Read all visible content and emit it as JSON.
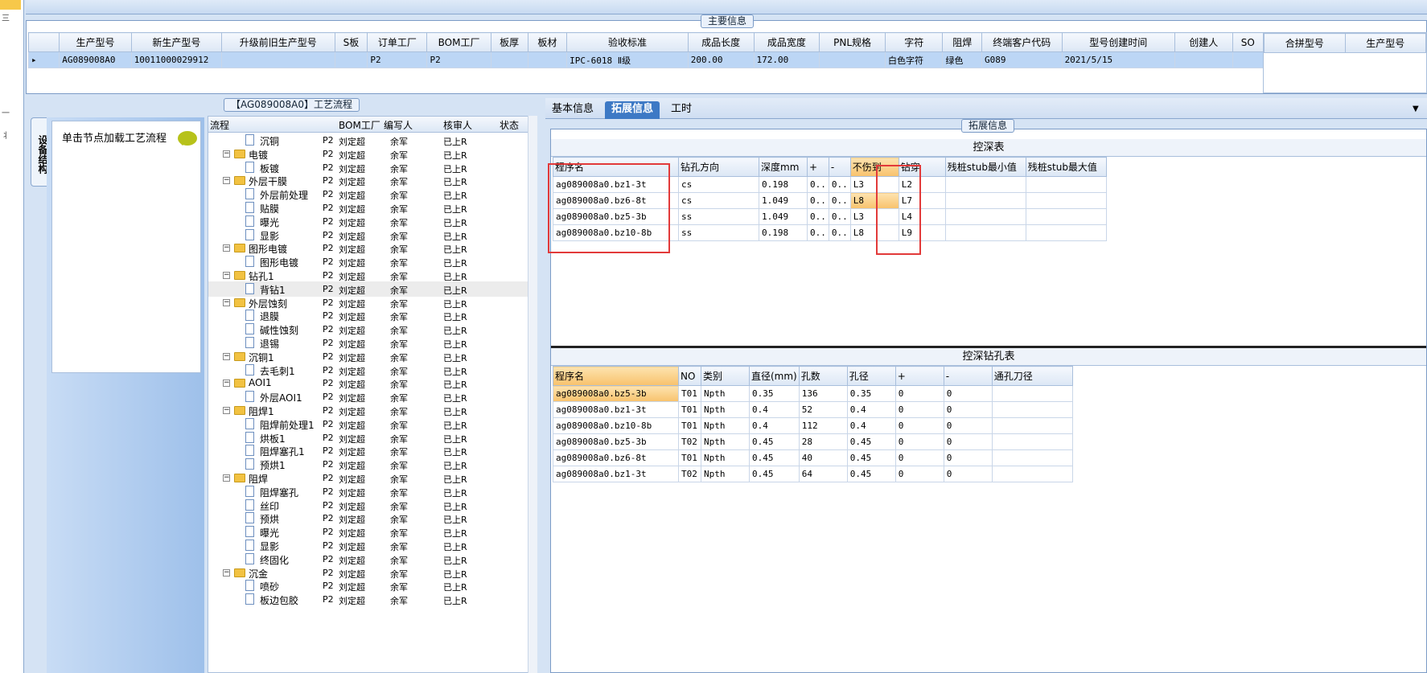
{
  "left_strip": {
    "marks": [
      "三",
      "一",
      "丬"
    ]
  },
  "main_info": {
    "title": "主要信息",
    "columns": [
      "生产型号",
      "新生产型号",
      "升级前旧生产型号",
      "S板",
      "订单工厂",
      "BOM工厂",
      "板厚",
      "板材",
      "验收标准",
      "成品长度",
      "成品宽度",
      "PNL规格",
      "字符",
      "阻焊",
      "终端客户代码",
      "型号创建时间",
      "创建人",
      "SO"
    ],
    "row": [
      "AG089008A0",
      "10011000029912",
      "",
      "",
      "P2",
      "P2",
      "",
      "",
      "IPC-6018 Ⅱ级",
      "200.00",
      "172.00",
      "",
      "白色字符",
      "绿色",
      "G089",
      "2021/5/15",
      "",
      ""
    ]
  },
  "combine": {
    "columns": [
      "合拼型号",
      "生产型号"
    ]
  },
  "process": {
    "title": "【AG089008A0】工艺流程",
    "side_tab": "设备结构",
    "hint": "单击节点加载工艺流程",
    "columns": [
      "流程",
      "BOM工厂",
      "编写人",
      "核审人",
      "状态"
    ],
    "rows": [
      {
        "name": "沉铜",
        "type": "doc",
        "bom": "P2",
        "writer": "刘定超",
        "reviewer": "余军",
        "status": "已上R"
      },
      {
        "name": "电镀",
        "type": "folder",
        "bom": "P2",
        "writer": "刘定超",
        "reviewer": "余军",
        "status": "已上R"
      },
      {
        "name": "板镀",
        "type": "doc",
        "bom": "P2",
        "writer": "刘定超",
        "reviewer": "余军",
        "status": "已上R"
      },
      {
        "name": "外层干膜",
        "type": "folder",
        "bom": "P2",
        "writer": "刘定超",
        "reviewer": "余军",
        "status": "已上R"
      },
      {
        "name": "外层前处理",
        "type": "doc",
        "bom": "P2",
        "writer": "刘定超",
        "reviewer": "余军",
        "status": "已上R"
      },
      {
        "name": "贴膜",
        "type": "doc",
        "bom": "P2",
        "writer": "刘定超",
        "reviewer": "余军",
        "status": "已上R"
      },
      {
        "name": "曝光",
        "type": "doc",
        "bom": "P2",
        "writer": "刘定超",
        "reviewer": "余军",
        "status": "已上R"
      },
      {
        "name": "显影",
        "type": "doc",
        "bom": "P2",
        "writer": "刘定超",
        "reviewer": "余军",
        "status": "已上R"
      },
      {
        "name": "图形电镀",
        "type": "folder",
        "bom": "P2",
        "writer": "刘定超",
        "reviewer": "余军",
        "status": "已上R"
      },
      {
        "name": "图形电镀",
        "type": "doc",
        "bom": "P2",
        "writer": "刘定超",
        "reviewer": "余军",
        "status": "已上R"
      },
      {
        "name": "钻孔1",
        "type": "folder",
        "bom": "P2",
        "writer": "刘定超",
        "reviewer": "余军",
        "status": "已上R"
      },
      {
        "name": "背钻1",
        "type": "doc",
        "bom": "P2",
        "writer": "刘定超",
        "reviewer": "余军",
        "status": "已上R",
        "selected": true
      },
      {
        "name": "外层蚀刻",
        "type": "folder",
        "bom": "P2",
        "writer": "刘定超",
        "reviewer": "余军",
        "status": "已上R"
      },
      {
        "name": "退膜",
        "type": "doc",
        "bom": "P2",
        "writer": "刘定超",
        "reviewer": "余军",
        "status": "已上R"
      },
      {
        "name": "碱性蚀刻",
        "type": "doc",
        "bom": "P2",
        "writer": "刘定超",
        "reviewer": "余军",
        "status": "已上R"
      },
      {
        "name": "退锡",
        "type": "doc",
        "bom": "P2",
        "writer": "刘定超",
        "reviewer": "余军",
        "status": "已上R"
      },
      {
        "name": "沉铜1",
        "type": "folder",
        "bom": "P2",
        "writer": "刘定超",
        "reviewer": "余军",
        "status": "已上R"
      },
      {
        "name": "去毛刺1",
        "type": "doc",
        "bom": "P2",
        "writer": "刘定超",
        "reviewer": "余军",
        "status": "已上R"
      },
      {
        "name": "AOI1",
        "type": "folder",
        "bom": "P2",
        "writer": "刘定超",
        "reviewer": "余军",
        "status": "已上R"
      },
      {
        "name": "外层AOI1",
        "type": "doc",
        "bom": "P2",
        "writer": "刘定超",
        "reviewer": "余军",
        "status": "已上R"
      },
      {
        "name": "阻焊1",
        "type": "folder",
        "bom": "P2",
        "writer": "刘定超",
        "reviewer": "余军",
        "status": "已上R"
      },
      {
        "name": "阻焊前处理1",
        "type": "doc",
        "bom": "P2",
        "writer": "刘定超",
        "reviewer": "余军",
        "status": "已上R"
      },
      {
        "name": "烘板1",
        "type": "doc",
        "bom": "P2",
        "writer": "刘定超",
        "reviewer": "余军",
        "status": "已上R"
      },
      {
        "name": "阻焊塞孔1",
        "type": "doc",
        "bom": "P2",
        "writer": "刘定超",
        "reviewer": "余军",
        "status": "已上R"
      },
      {
        "name": "预烘1",
        "type": "doc",
        "bom": "P2",
        "writer": "刘定超",
        "reviewer": "余军",
        "status": "已上R"
      },
      {
        "name": "阻焊",
        "type": "folder",
        "bom": "P2",
        "writer": "刘定超",
        "reviewer": "余军",
        "status": "已上R"
      },
      {
        "name": "阻焊塞孔",
        "type": "doc",
        "bom": "P2",
        "writer": "刘定超",
        "reviewer": "余军",
        "status": "已上R"
      },
      {
        "name": "丝印",
        "type": "doc",
        "bom": "P2",
        "writer": "刘定超",
        "reviewer": "余军",
        "status": "已上R"
      },
      {
        "name": "预烘",
        "type": "doc",
        "bom": "P2",
        "writer": "刘定超",
        "reviewer": "余军",
        "status": "已上R"
      },
      {
        "name": "曝光",
        "type": "doc",
        "bom": "P2",
        "writer": "刘定超",
        "reviewer": "余军",
        "status": "已上R"
      },
      {
        "name": "显影",
        "type": "doc",
        "bom": "P2",
        "writer": "刘定超",
        "reviewer": "余军",
        "status": "已上R"
      },
      {
        "name": "终固化",
        "type": "doc",
        "bom": "P2",
        "writer": "刘定超",
        "reviewer": "余军",
        "status": "已上R"
      },
      {
        "name": "沉金",
        "type": "folder",
        "bom": "P2",
        "writer": "刘定超",
        "reviewer": "余军",
        "status": "已上R"
      },
      {
        "name": "喷砂",
        "type": "doc",
        "bom": "P2",
        "writer": "刘定超",
        "reviewer": "余军",
        "status": "已上R"
      },
      {
        "name": "板边包胶",
        "type": "doc",
        "bom": "P2",
        "writer": "刘定超",
        "reviewer": "余军",
        "status": "已上R"
      }
    ]
  },
  "tabs": [
    "基本信息",
    "拓展信息",
    "工时"
  ],
  "ext": {
    "title": "拓展信息",
    "depth_table": {
      "title": "控深表",
      "columns": [
        "程序名",
        "钻孔方向",
        "深度mm",
        "+",
        "-",
        "不伤到",
        "钻穿",
        "残桩stub最小值",
        "残桩stub最大值"
      ],
      "rows": [
        [
          "ag089008a0.bz1-3t",
          "cs",
          "0.198",
          "0..",
          "0..",
          "L3",
          "L2",
          "",
          ""
        ],
        [
          "ag089008a0.bz6-8t",
          "cs",
          "1.049",
          "0..",
          "0..",
          "L8",
          "L7",
          "",
          ""
        ],
        [
          "ag089008a0.bz5-3b",
          "ss",
          "1.049",
          "0..",
          "0..",
          "L3",
          "L4",
          "",
          ""
        ],
        [
          "ag089008a0.bz10-8b",
          "ss",
          "0.198",
          "0..",
          "0..",
          "L8",
          "L9",
          "",
          ""
        ]
      ]
    },
    "hole_table": {
      "title": "控深钻孔表",
      "columns": [
        "程序名",
        "NO",
        "类别",
        "直径(mm)",
        "孔数",
        "孔径",
        "+",
        "-",
        "通孔刀径"
      ],
      "rows": [
        [
          "ag089008a0.bz5-3b",
          "T01",
          "Npth",
          "0.35",
          "136",
          "0.35",
          "0",
          "0",
          ""
        ],
        [
          "ag089008a0.bz1-3t",
          "T01",
          "Npth",
          "0.4",
          "52",
          "0.4",
          "0",
          "0",
          ""
        ],
        [
          "ag089008a0.bz10-8b",
          "T01",
          "Npth",
          "0.4",
          "112",
          "0.4",
          "0",
          "0",
          ""
        ],
        [
          "ag089008a0.bz5-3b",
          "T02",
          "Npth",
          "0.45",
          "28",
          "0.45",
          "0",
          "0",
          ""
        ],
        [
          "ag089008a0.bz6-8t",
          "T01",
          "Npth",
          "0.45",
          "40",
          "0.45",
          "0",
          "0",
          ""
        ],
        [
          "ag089008a0.bz1-3t",
          "T02",
          "Npth",
          "0.45",
          "64",
          "0.45",
          "0",
          "0",
          ""
        ]
      ]
    }
  }
}
